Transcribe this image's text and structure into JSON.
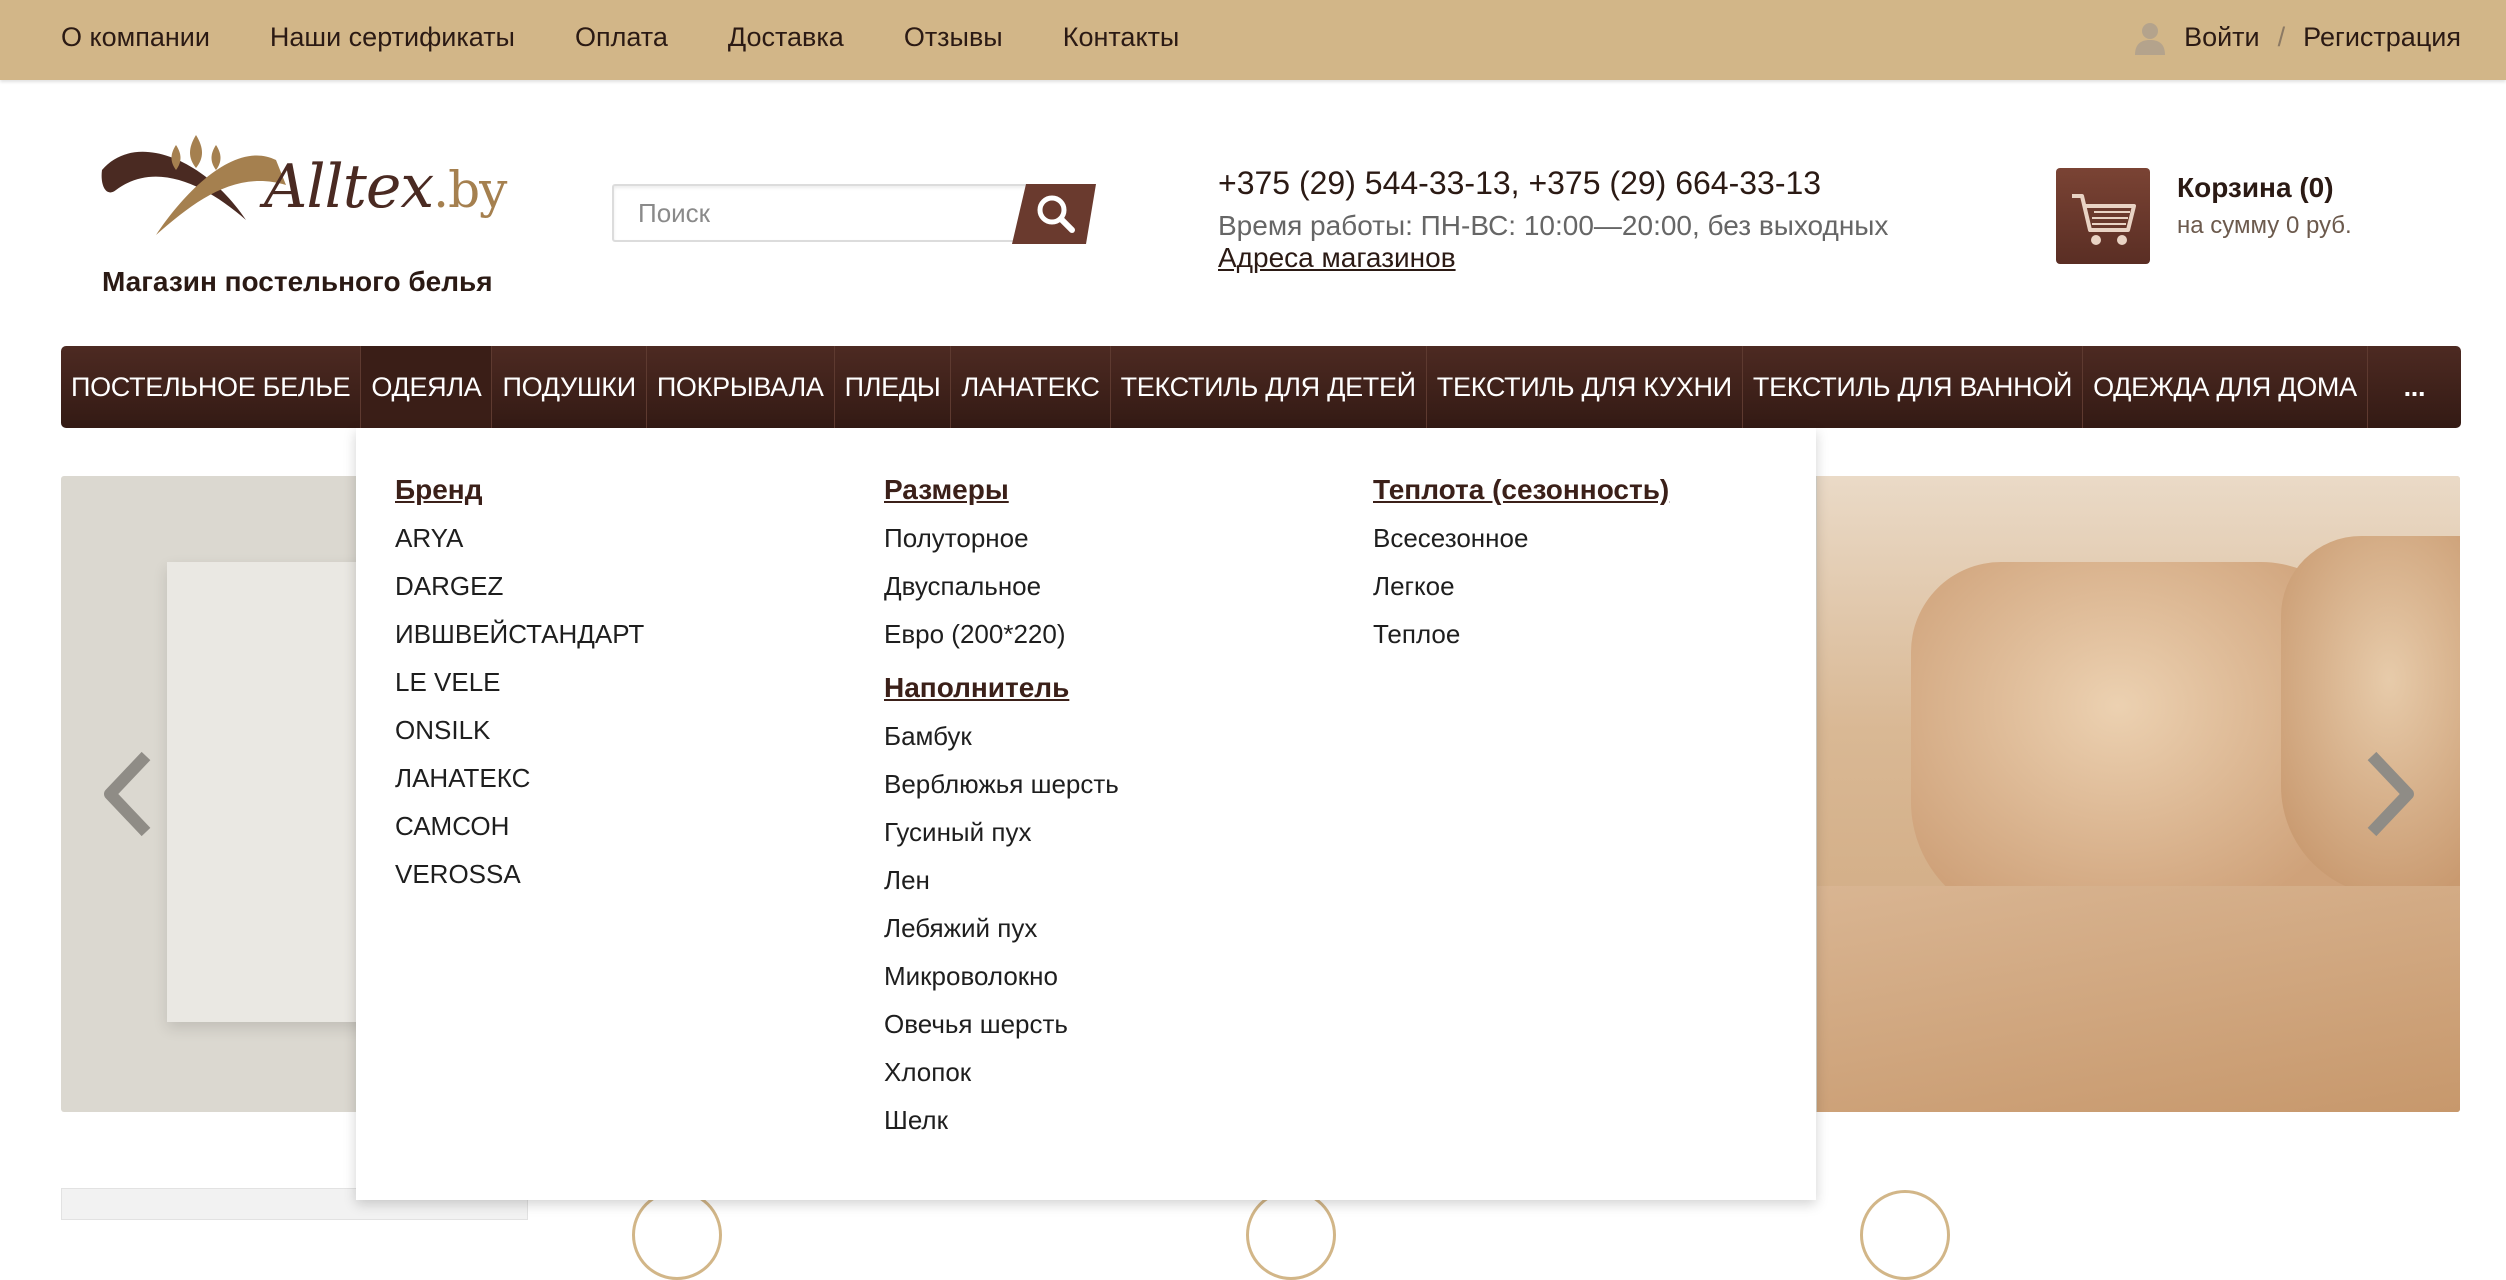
{
  "topbar": {
    "links": [
      "О компании",
      "Наши сертификаты",
      "Оплата",
      "Доставка",
      "Отзывы",
      "Контакты"
    ],
    "login": "Войти",
    "separator": "/",
    "register": "Регистрация"
  },
  "header": {
    "logo_main": "Alltex",
    "logo_suffix": ".by",
    "tagline": "Магазин постельного белья",
    "search_placeholder": "Поиск",
    "phones": "+375 (29) 544-33-13, +375 (29) 664-33-13",
    "hours": "Время работы: ПН-ВС: 10:00—20:00, без выходных",
    "addresses_link": "Адреса магазинов",
    "cart_title": "Корзина (0)",
    "cart_sum": "на сумму 0 руб."
  },
  "mainnav": {
    "items": [
      "ПОСТЕЛЬНОЕ БЕЛЬЕ",
      "ОДЕЯЛА",
      "ПОДУШКИ",
      "ПОКРЫВАЛА",
      "ПЛЕДЫ",
      "ЛАНАТЕКС",
      "ТЕКСТИЛЬ ДЛЯ ДЕТЕЙ",
      "ТЕКСТИЛЬ ДЛЯ КУХНИ",
      "ТЕКСТИЛЬ ДЛЯ ВАННОЙ",
      "ОДЕЖДА ДЛЯ ДОМА"
    ],
    "more": "...",
    "active_index": 1
  },
  "dropdown": {
    "brand": {
      "title": "Бренд",
      "items": [
        "ARYA",
        "DARGEZ",
        "ИВШВЕЙСТАНДАРТ",
        "LE VELE",
        "ONSILK",
        "ЛАНАТЕКС",
        "САМСОН",
        "VEROSSA"
      ]
    },
    "sizes": {
      "title": "Размеры",
      "items": [
        "Полуторное",
        "Двуспальное",
        "Евро (200*220)"
      ]
    },
    "filler": {
      "title": "Наполнитель",
      "items": [
        "Бамбук",
        "Верблюжья шерсть",
        "Гусиный пух",
        "Лен",
        "Лебяжий пух",
        "Микроволокно",
        "Овечья шерсть",
        "Хлопок",
        "Шелк"
      ]
    },
    "warmth": {
      "title": "Теплота (сезонность)",
      "items": [
        "Всесезонное",
        "Легкое",
        "Теплое"
      ]
    }
  },
  "colors": {
    "topbar": "#d2b688",
    "nav": "#3f211a",
    "accent": "#6a3a2e"
  },
  "icons": {
    "user": "user-icon",
    "search": "search-icon",
    "cart": "cart-icon",
    "prev": "chevron-left-icon",
    "next": "chevron-right-icon"
  }
}
